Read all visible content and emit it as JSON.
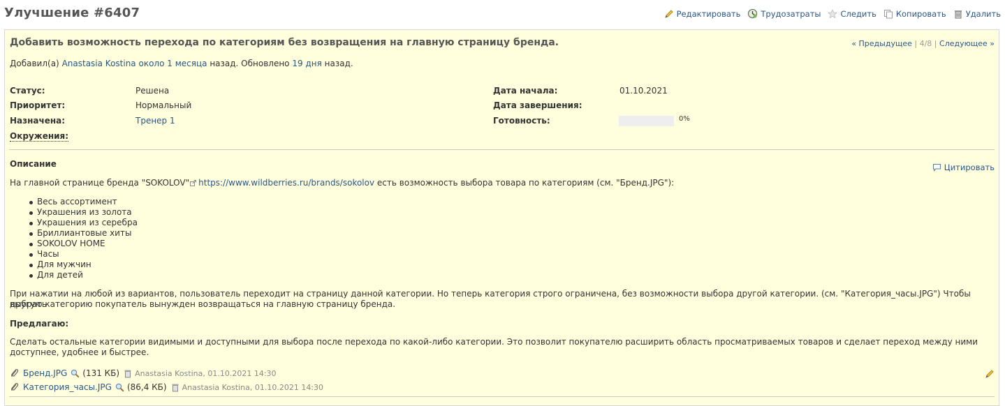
{
  "page": {
    "title": "Улучшение #6407"
  },
  "actions": [
    {
      "label": "Редактировать",
      "icon": "pencil-icon"
    },
    {
      "label": "Трудозатраты",
      "icon": "clock-icon"
    },
    {
      "label": "Следить",
      "icon": "star-icon"
    },
    {
      "label": "Копировать",
      "icon": "copy-icon"
    },
    {
      "label": "Удалить",
      "icon": "trash-icon"
    }
  ],
  "issue": {
    "subject": "Добавить возможность перехода по категориям без возвращения на главную страницу бренда.",
    "prevnext": {
      "prev": "« Предыдущее",
      "sep1": "|",
      "counter": "4/8",
      "sep2": "|",
      "next": "Следующее »"
    },
    "author": {
      "prefix": "Добавил(а)",
      "name": "Anastasia Kostina",
      "time_link": "около 1 месяца",
      "middle": "назад. Обновлено",
      "updated_link": "19 дня",
      "suffix": "назад."
    },
    "attributes": {
      "status": {
        "label": "Статус:",
        "value": "Решена"
      },
      "priority": {
        "label": "Приоритет:",
        "value": "Нормальный"
      },
      "assigned": {
        "label": "Назначена:",
        "value": "Тренер 1"
      },
      "environment": {
        "label": "Окружения:",
        "value": ""
      },
      "start_date": {
        "label": "Дата начала:",
        "value": "01.10.2021"
      },
      "due_date": {
        "label": "Дата завершения:",
        "value": ""
      },
      "done": {
        "label": "Готовность:",
        "value": "0%",
        "percent": 0
      }
    },
    "description": {
      "heading": "Описание",
      "quote_label": "Цитировать",
      "intro_before": "На главной странице бренда \"SOKOLOV\"",
      "intro_link": "https://www.wildberries.ru/brands/sokolov",
      "intro_after": "есть возможность выбора товара по категориям (см. \"Бренд.JPG\"):",
      "items": [
        "Весь ассортимент",
        "Украшения из золота",
        "Украшения из серебра",
        "Бриллиантовые хиты",
        "SOKOLOV HOME",
        "Часы",
        "Для мужчин",
        "Для детей"
      ],
      "para1_line1": "При нажатии на любой из вариантов, пользователь переходит на страницу данной категории. Но теперь категория строго ограничена, без возможности выбора другой категории. (см. \"Категория_часы.JPG\") Чтобы выбрать",
      "para1_line2": "другую категорию покупатель вынужден возвращаться на главную страницу бренда.",
      "proposal_heading": "Предлагаю:",
      "para2_line1": "Сделать остальные категории видимыми и доступными для выбора после перехода по какой-либо категории. Это позволит покупателю расширить область просматриваемых товаров и сделает переход между ними",
      "para2_line2": "доступнее, удобнее и быстрее."
    },
    "attachments": [
      {
        "name": "Бренд.JPG",
        "size": "(131 КБ)",
        "meta": "Anastasia Kostina, 01.10.2021 14:30"
      },
      {
        "name": "Категория_часы.JPG",
        "size": "(86,4 КБ)",
        "meta": "Anastasia Kostina, 01.10.2021 14:30"
      }
    ]
  },
  "colors": {
    "link": "#2a5685",
    "box_background": "#ffffdd",
    "box_border": "#d7d7d7",
    "progress_empty": "#eeeeee"
  }
}
